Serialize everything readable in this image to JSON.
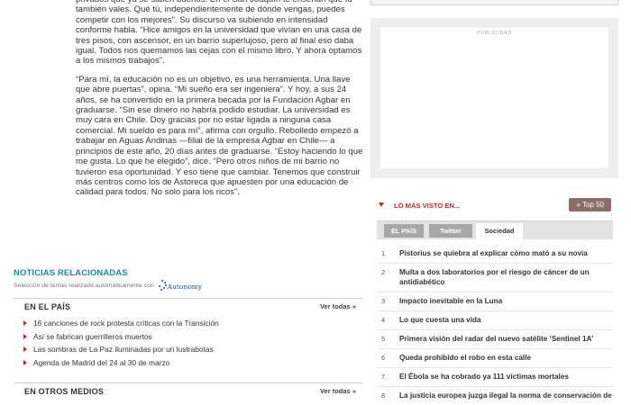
{
  "article": {
    "paragraphs": [
      "privados que ya se saben buenos. En el San Joaquín te enseñan que tú también vales. Qué tú, independientemente de dónde vengas, puedes competir con los mejores”. Su discurso va subiendo en intensidad conforme habla. “Hice amigos en la universidad que vivían en una casa de tres pisos, con ascensor, en un barrio superlujoso, pero al final eso daba igual. Todos nos quemamos las cejas con el mismo libro. Y ahora optamos a los mismos trabajos”.",
      "“Para mí, la educación no es un objetivo, es una herramienta. Una llave que abre puertas”, opina. “Mi sueño era ser ingeniera”. Y hoy, a sus 24 años, se ha convertido en la primera becada por la Fundación Agbar en graduarse. “Sin ese dinero no habría podido estudiar. La universidad es muy cara en Chile. Doy gracias por no estar ligada a ninguna casa comercial. Mi sueldo es para mí”, afirma con orgullo. Rebolledo empezó a trabajar en Aguas Andinas —filial de la empresa Agbar en Chile— a principios de este año, 20 días antes de graduarse. “Estoy haciendo lo que me gusta. Lo que he elegido”, dice. “Pero otros niños de mi barrio no tuvieron esa oportunidad. Y eso tiene que cambiar. Tenemos que construir más centros como los de Astoreca que apuesten por una educación de calidad para todos. No solo para los ricos”."
    ]
  },
  "related": {
    "title": "NOTICIAS RELACIONADAS",
    "subtitle": "Selección de temas realizada automáticamente con",
    "logo_text": "Autonomy",
    "sections": [
      {
        "label": "EN EL PAÍS",
        "more": "Ver todas »",
        "items": [
          "16 canciones de rock protesta críticas con la Transición",
          "Así se fabrican guerrilleros muertos",
          "Las sombras de La Paz iluminadas por un lustrabotas",
          "Agenda de Madrid del 24 al 30 de marzo"
        ]
      },
      {
        "label": "EN OTROS MEDIOS",
        "more": "Ver todas »"
      }
    ]
  },
  "sidebar": {
    "ad_label": "PUBLICIDAD",
    "most_viewed": {
      "title": "LO MÁS VISTO EN...",
      "top50": "» Top 50",
      "tabs": [
        "EL PAÍS",
        "Twitter",
        "Sociedad"
      ],
      "active_tab": "Sociedad",
      "items": [
        {
          "num": "1",
          "text": "Pistorius se quiebra al explicar cómo mató a su novia"
        },
        {
          "num": "2",
          "text": "Multa a dos laboratorios por el riesgo de cáncer de un antidiabético"
        },
        {
          "num": "3",
          "text": "Impacto inevitable en la Luna"
        },
        {
          "num": "4",
          "text": "Lo que cuesta una vida"
        },
        {
          "num": "5",
          "text": "Primera visión del radar del nuevo satélite ‘Sentinel 1A’"
        },
        {
          "num": "6",
          "text": "Queda prohibido el robo en esta calle"
        },
        {
          "num": "7",
          "text": "El Ébola se ha cobrado ya 111 víctimas mortales"
        },
        {
          "num": "8",
          "text": "La justicia europea juzga ilegal la norma de conservación de"
        }
      ]
    }
  },
  "colors": {
    "related_title": "#1e8b97",
    "accent_red": "#b0322e",
    "top50_bg": "#8a6e68"
  }
}
